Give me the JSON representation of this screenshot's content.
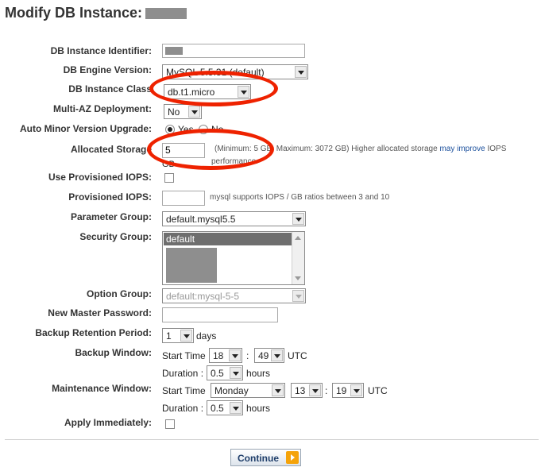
{
  "page": {
    "title": "Modify DB Instance:"
  },
  "form": {
    "identifier": {
      "label": "DB Instance Identifier:"
    },
    "engine_version": {
      "label": "DB Engine Version:",
      "value": "MySQL 5.5.31 (default)"
    },
    "instance_class": {
      "label": "DB Instance Class",
      "value": "db.t1.micro"
    },
    "multi_az": {
      "label": "Multi-AZ Deployment:",
      "value": "No"
    },
    "auto_minor": {
      "label": "Auto Minor Version Upgrade:",
      "yes": "Yes",
      "no": "No"
    },
    "storage": {
      "label": "Allocated Storage",
      "value": "5",
      "unit": "GB",
      "note_pre": "(Minimum: 5 GB, Maximum: 3072 GB) Higher allocated storage ",
      "note_link": "may improve",
      "note_post": " IOPS",
      "note_line2": "performance."
    },
    "provisioned_iops_use": {
      "label": "Use Provisioned IOPS:"
    },
    "provisioned_iops": {
      "label": "Provisioned IOPS:",
      "note": "mysql supports IOPS / GB ratios between 3 and 10"
    },
    "parameter_group": {
      "label": "Parameter Group:",
      "value": "default.mysql5.5"
    },
    "security_group": {
      "label": "Security Group:",
      "selected": "default"
    },
    "option_group": {
      "label": "Option Group:",
      "value": "default:mysql-5-5"
    },
    "master_password": {
      "label": "New Master Password:"
    },
    "backup_retention": {
      "label": "Backup Retention Period:",
      "value": "1",
      "unit": "days"
    },
    "backup_window": {
      "label": "Backup Window:",
      "start_label": "Start Time",
      "hour": "18",
      "sep": ":",
      "minute": "49",
      "tz": "UTC",
      "duration_label": "Duration :",
      "duration": "0.5",
      "duration_unit": "hours"
    },
    "maintenance_window": {
      "label": "Maintenance Window:",
      "start_label": "Start Time",
      "day": "Monday",
      "hour": "13",
      "sep": ":",
      "minute": "19",
      "tz": "UTC",
      "duration_label": "Duration :",
      "duration": "0.5",
      "duration_unit": "hours"
    },
    "apply_immediately": {
      "label": "Apply Immediately:"
    }
  },
  "actions": {
    "continue_label": "Continue"
  },
  "colors": {
    "highlight_oval": "#ee2200",
    "continue_icon": "#f5a30a"
  }
}
